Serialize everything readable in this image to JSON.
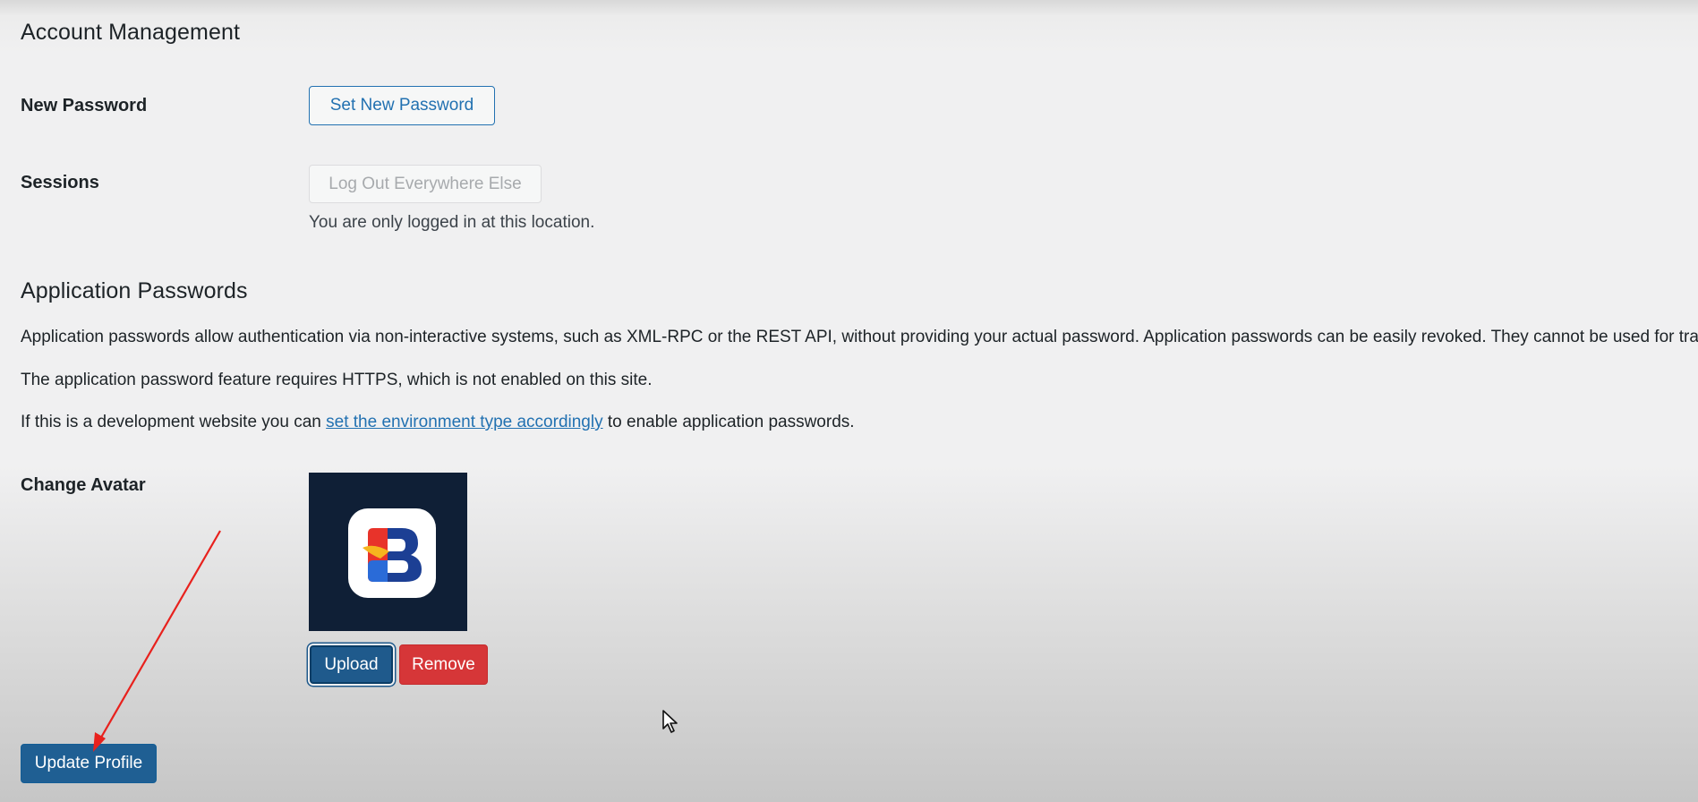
{
  "account_management": {
    "heading": "Account Management",
    "new_password": {
      "label": "New Password",
      "button": "Set New Password"
    },
    "sessions": {
      "label": "Sessions",
      "button": "Log Out Everywhere Else",
      "description": "You are only logged in at this location."
    }
  },
  "application_passwords": {
    "heading": "Application Passwords",
    "intro": "Application passwords allow authentication via non-interactive systems, such as XML-RPC or the REST API, without providing your actual password. Application passwords can be easily revoked. They cannot be used for traditi",
    "https_notice": "The application password feature requires HTTPS, which is not enabled on this site.",
    "dev_notice_before": "If this is a development website you can ",
    "dev_notice_link": "set the environment type accordingly",
    "dev_notice_after": " to enable application passwords."
  },
  "avatar": {
    "label": "Change Avatar",
    "image_icon": "b-logo-icon",
    "upload_button": "Upload",
    "remove_button": "Remove"
  },
  "footer": {
    "update_button": "Update Profile"
  },
  "annotations": {
    "arrow_color": "#e8211d",
    "cursor_icon": "mouse-pointer-icon"
  },
  "colors": {
    "accent": "#2271b1",
    "danger": "#d63638",
    "avatar_bg": "#0f1f36"
  }
}
